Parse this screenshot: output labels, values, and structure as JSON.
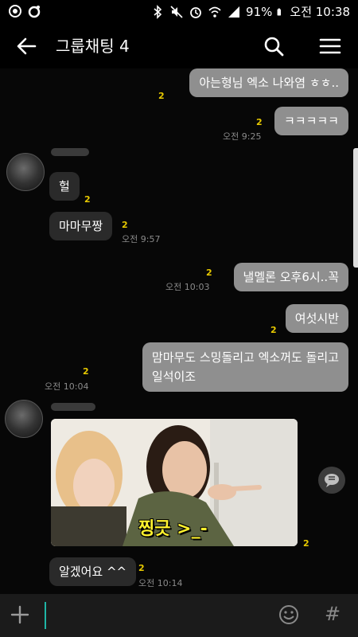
{
  "status_bar": {
    "battery": "91%",
    "time": "오전 10:38"
  },
  "app_bar": {
    "title": "그룹채팅 4"
  },
  "messages": [
    {
      "dir": "out",
      "text": "아는형님 엑소 나와염 ㅎㅎ..",
      "unread": "2",
      "time": ""
    },
    {
      "dir": "out",
      "text": "ㅋㅋㅋㅋㅋ",
      "unread": "2",
      "time": "오전 9:25"
    },
    {
      "dir": "in",
      "text": "헐",
      "unread": "2",
      "time": ""
    },
    {
      "dir": "in",
      "text": "마마무짱",
      "unread": "2",
      "time": "오전 9:57"
    },
    {
      "dir": "out",
      "text": "낼멜론  오후6시..꼭",
      "unread": "2",
      "time": "오전 10:03"
    },
    {
      "dir": "out",
      "text": "여섯시반",
      "unread": "2",
      "time": ""
    },
    {
      "dir": "out",
      "text_lines": [
        "맘마무도 스밍돌리고 엑소꺼도 돌리고",
        "일석이조"
      ],
      "unread": "2",
      "time": "오전 10:04"
    },
    {
      "dir": "in",
      "image_caption": "찡긋 >_-",
      "unread": "2",
      "time": ""
    },
    {
      "dir": "in",
      "text": "알겠어요 ^^",
      "unread": "2",
      "time": "오전 10:14"
    }
  ],
  "icons": {
    "back": "arrow-left-icon",
    "search": "search-icon",
    "menu": "hamburger-menu-icon",
    "share": "share-bubble-icon",
    "plus": "plus-icon",
    "emoji": "emoji-icon",
    "hash": "#"
  },
  "input": {
    "value": "",
    "placeholder": ""
  },
  "colors": {
    "outgoing_bubble": "#8f8f8f",
    "incoming_bubble": "#2a2a2a",
    "unread_count": "#e6c800",
    "cursor": "#1fb5a6"
  }
}
